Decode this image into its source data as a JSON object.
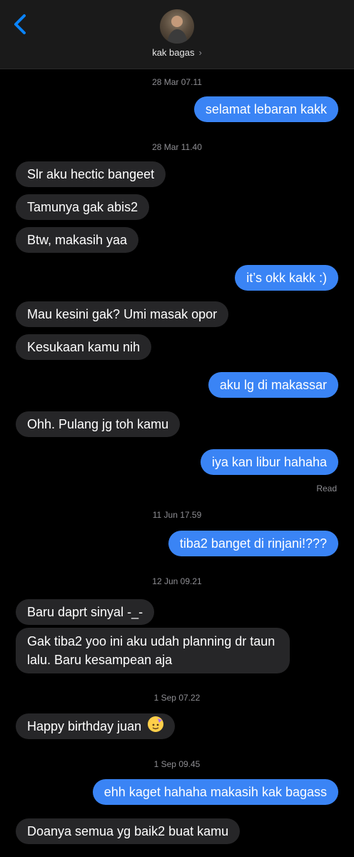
{
  "header": {
    "contact_name": "kak bagas",
    "chevron": "›"
  },
  "messages": [
    {
      "type": "timestamp",
      "text": "28 Mar 07.11"
    },
    {
      "type": "out",
      "text": "selamat lebaran kakk"
    },
    {
      "type": "timestamp",
      "text": "28 Mar 11.40"
    },
    {
      "type": "in",
      "text": "Slr aku hectic bangeet"
    },
    {
      "type": "in",
      "text": "Tamunya gak abis2"
    },
    {
      "type": "in",
      "text": "Btw, makasih yaa"
    },
    {
      "type": "out",
      "text": "it’s okk kakk :)"
    },
    {
      "type": "in",
      "text": "Mau kesini gak? Umi masak opor"
    },
    {
      "type": "in",
      "text": "Kesukaan kamu nih"
    },
    {
      "type": "out",
      "text": "aku lg di makassar"
    },
    {
      "type": "in",
      "text": "Ohh. Pulang jg toh kamu"
    },
    {
      "type": "out",
      "text": "iya kan libur hahaha"
    },
    {
      "type": "status",
      "text": "Read"
    },
    {
      "type": "timestamp",
      "text": "11 Jun 17.59"
    },
    {
      "type": "out",
      "text": "tiba2 banget di rinjani!???"
    },
    {
      "type": "timestamp",
      "text": "12 Jun 09.21"
    },
    {
      "type": "in",
      "text": "Baru daprt sinyal -_-"
    },
    {
      "type": "in",
      "text": "Gak tiba2 yoo ini aku udah planning dr taun lalu. Baru kesampean aja"
    },
    {
      "type": "timestamp",
      "text": "1 Sep 07.22"
    },
    {
      "type": "in",
      "text": "Happy birthday juan",
      "icon": "partying-face-emoji-icon"
    },
    {
      "type": "timestamp",
      "text": "1 Sep 09.45"
    },
    {
      "type": "out",
      "text": "ehh kaget hahaha makasih kak bagass"
    },
    {
      "type": "in",
      "text": "Doanya semua yg baik2 buat kamu"
    }
  ],
  "colors": {
    "background": "#000000",
    "header": "#1a1a1a",
    "incoming_bubble": "#262628",
    "outgoing_bubble": "#3a84f5",
    "meta_text": "#8e8e93",
    "accent": "#0a84ff"
  }
}
